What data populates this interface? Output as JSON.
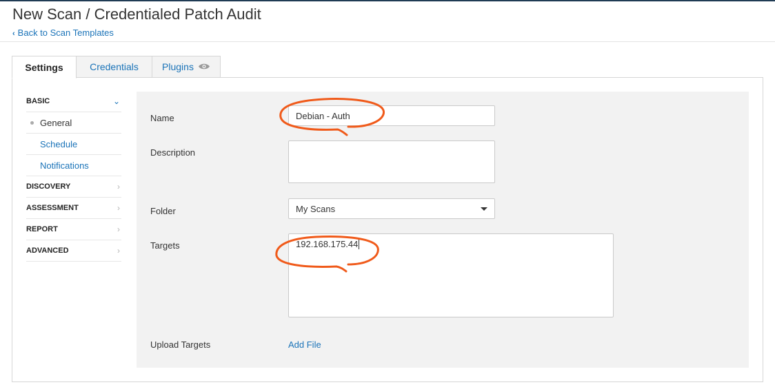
{
  "page": {
    "title": "New Scan / Credentialed Patch Audit",
    "back_link": "Back to Scan Templates"
  },
  "tabs": [
    {
      "label": "Settings",
      "active": true
    },
    {
      "label": "Credentials",
      "active": false
    },
    {
      "label": "Plugins",
      "active": false,
      "icon": "eye-icon"
    }
  ],
  "sidebar": {
    "sections": [
      {
        "label": "BASIC",
        "expanded": true
      },
      {
        "label": "DISCOVERY",
        "expanded": false
      },
      {
        "label": "ASSESSMENT",
        "expanded": false
      },
      {
        "label": "REPORT",
        "expanded": false
      },
      {
        "label": "ADVANCED",
        "expanded": false
      }
    ],
    "basic_items": [
      {
        "label": "General",
        "current": true
      },
      {
        "label": "Schedule",
        "current": false
      },
      {
        "label": "Notifications",
        "current": false
      }
    ]
  },
  "form": {
    "name": {
      "label": "Name",
      "value": "Debian - Auth"
    },
    "description": {
      "label": "Description",
      "value": ""
    },
    "folder": {
      "label": "Folder",
      "value": "My Scans"
    },
    "targets": {
      "label": "Targets",
      "value": "192.168.175.44"
    },
    "upload_targets": {
      "label": "Upload Targets",
      "link": "Add File"
    }
  },
  "colors": {
    "link": "#1a73b8",
    "annotation": "#f05a1a",
    "form_background": "#f2f2f2",
    "top_bar": "#1f3b54"
  }
}
